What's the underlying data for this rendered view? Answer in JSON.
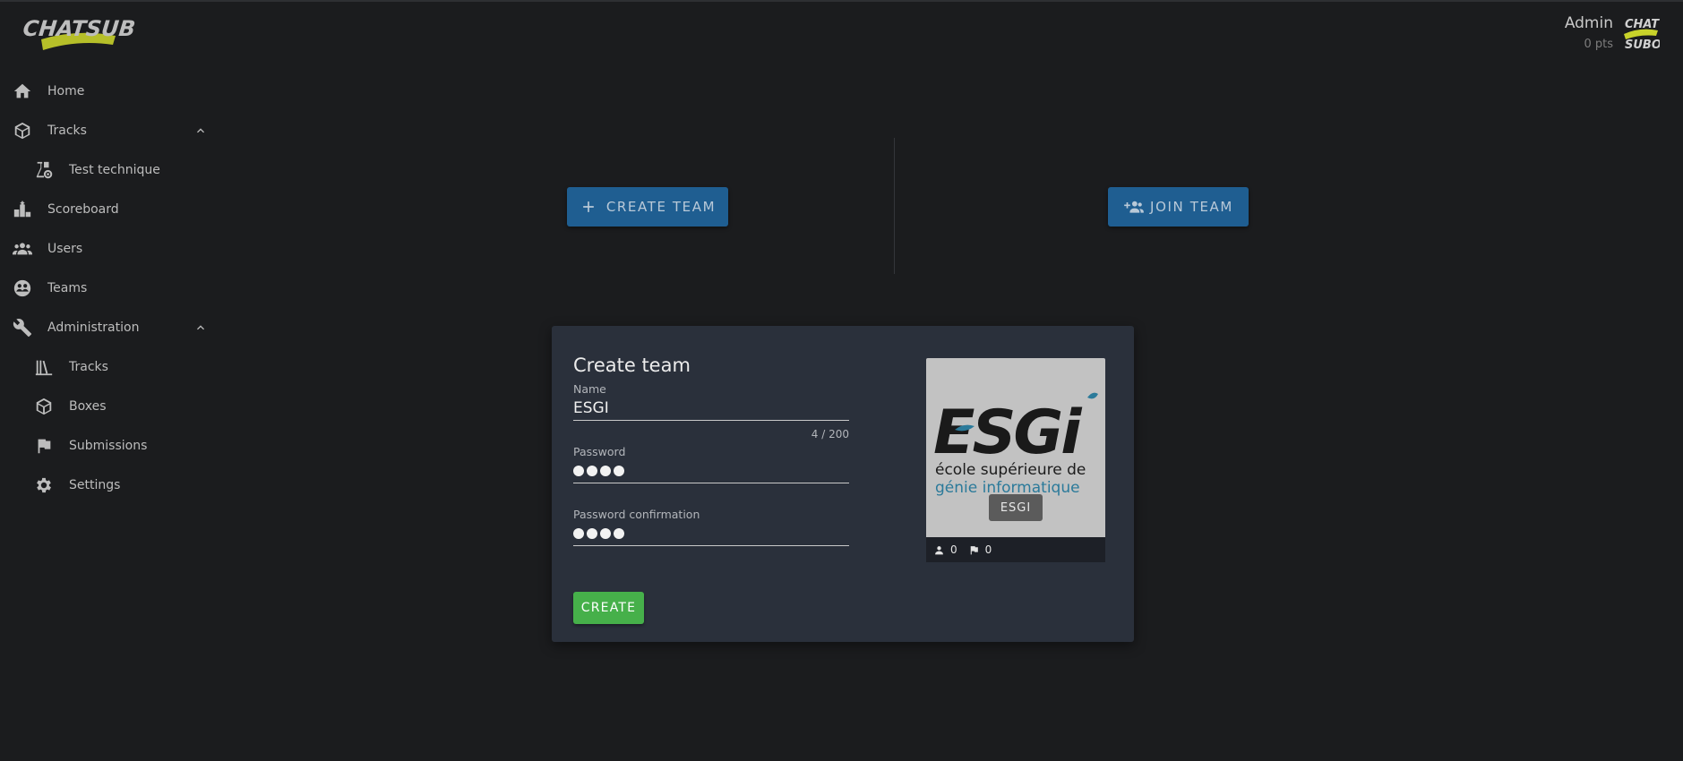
{
  "brand": {
    "logo_text": "CHATSUBO"
  },
  "user": {
    "name": "Admin",
    "points": "0 pts",
    "avatar_text": "CHAT SUBO"
  },
  "sidebar": {
    "items": [
      {
        "label": "Home",
        "icon": "home-icon"
      },
      {
        "label": "Tracks",
        "icon": "cube-icon",
        "expanded": true
      },
      {
        "label": "Test technique",
        "icon": "flask-gear-icon"
      },
      {
        "label": "Scoreboard",
        "icon": "scoreboard-icon"
      },
      {
        "label": "Users",
        "icon": "users-icon"
      },
      {
        "label": "Teams",
        "icon": "teams-icon"
      },
      {
        "label": "Administration",
        "icon": "wrench-icon",
        "expanded": true
      },
      {
        "label": "Tracks",
        "icon": "library-icon"
      },
      {
        "label": "Boxes",
        "icon": "cube-icon"
      },
      {
        "label": "Submissions",
        "icon": "flag-icon"
      },
      {
        "label": "Settings",
        "icon": "gear-icon"
      }
    ]
  },
  "actions": {
    "create_team": "CREATE TEAM",
    "join_team": "JOIN TEAM"
  },
  "form": {
    "title": "Create team",
    "name_label": "Name",
    "name_value": "ESGI",
    "name_counter": "4 / 200",
    "password_label": "Password",
    "password_confirm_label": "Password confirmation",
    "submit_label": "CREATE"
  },
  "preview": {
    "logo_line1": "école supérieure de",
    "logo_line2": "génie informatique",
    "team_name": "ESGI",
    "members": "0",
    "flags": "0"
  },
  "colors": {
    "background": "#1b1c1e",
    "card": "#2a303b",
    "primary": "#1f5e91",
    "success": "#46b04a",
    "logo_accent": "#c8d22a"
  }
}
